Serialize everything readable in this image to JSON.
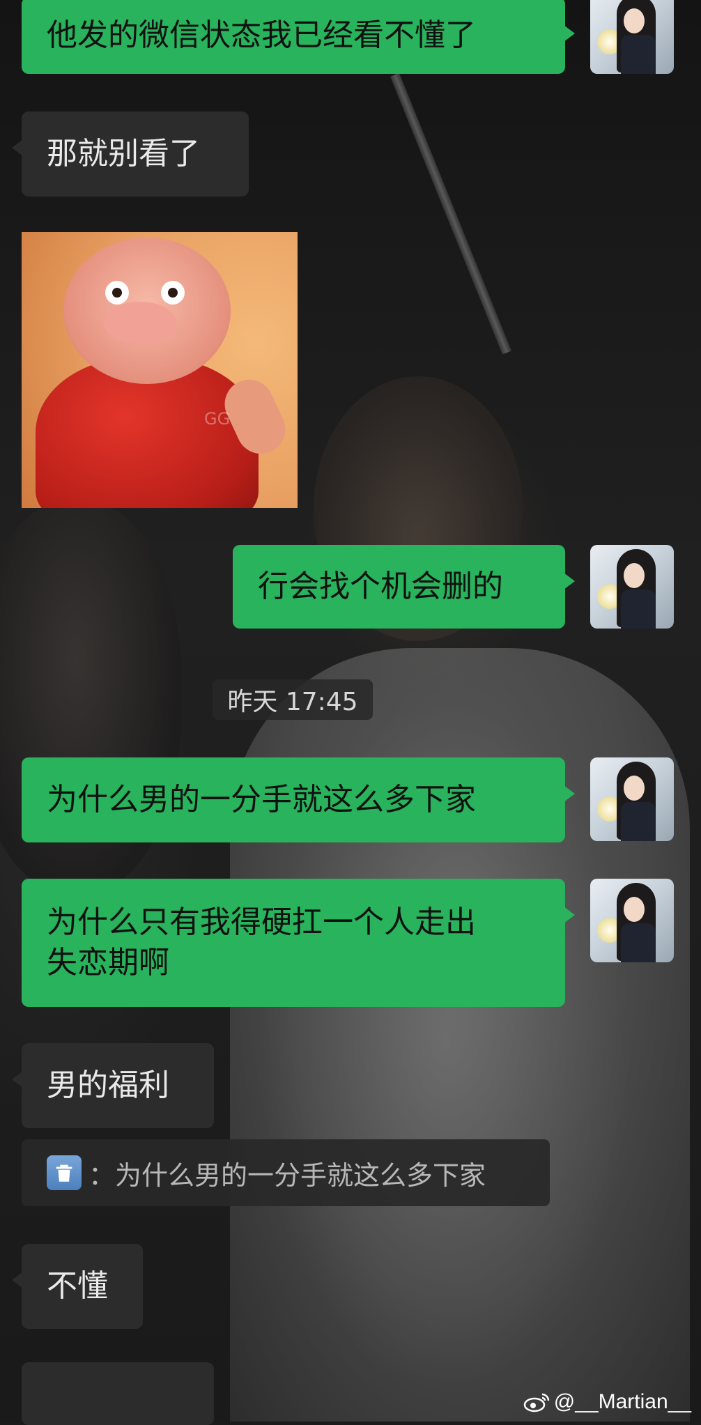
{
  "messages": [
    {
      "id": "m1",
      "side": "mine",
      "text": "他发的微信状态我已经看不懂了"
    },
    {
      "id": "m2",
      "side": "theirs",
      "text": "那就别看了"
    },
    {
      "id": "m3",
      "side": "theirs",
      "type": "sticker",
      "watermark": "GG"
    },
    {
      "id": "m4",
      "side": "mine",
      "text": "行会找个机会删的"
    },
    {
      "id": "m5",
      "side": "mine",
      "text": "为什么男的一分手就这么多下家"
    },
    {
      "id": "m6",
      "side": "mine",
      "text_line1": "为什么只有我得硬扛一个人走出",
      "text_line2": "失恋期啊"
    },
    {
      "id": "m7",
      "side": "theirs",
      "text": "男的福利"
    },
    {
      "id": "m8",
      "side": "theirs",
      "type": "quote",
      "text": "：为什么男的一分手就这么多下家",
      "icon": "trash-icon"
    },
    {
      "id": "m9",
      "side": "theirs",
      "text": "不懂"
    }
  ],
  "timestamp": "昨天 17:45",
  "watermark": "@__Martian__",
  "colors": {
    "mine_bubble": "#28b35c",
    "theirs_bubble": "#2c2c2c",
    "text_light": "#eaeaea"
  }
}
